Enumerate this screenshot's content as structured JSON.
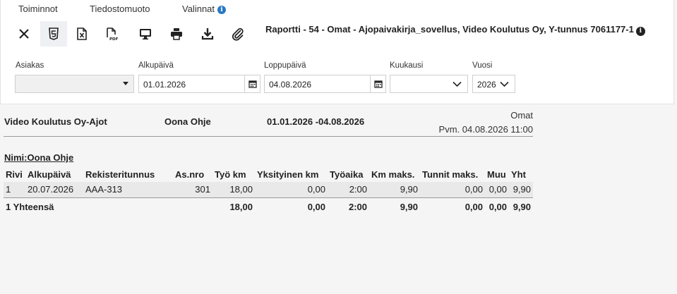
{
  "menu": {
    "toiminnot": "Toiminnot",
    "tiedostomuoto": "Tiedostomuoto",
    "valinnat": "Valinnat"
  },
  "toolbar": [
    {
      "name": "close-icon",
      "icon": "close"
    },
    {
      "name": "html5-icon",
      "icon": "html5"
    },
    {
      "name": "excel-icon",
      "icon": "excel"
    },
    {
      "name": "pdf-icon",
      "icon": "pdf"
    },
    {
      "name": "monitor-icon",
      "icon": "monitor"
    },
    {
      "name": "printer-icon",
      "icon": "printer"
    },
    {
      "name": "download-icon",
      "icon": "download"
    },
    {
      "name": "paperclip-icon",
      "icon": "paperclip"
    }
  ],
  "report_title": "Raportti - 54 - Omat - Ajopaivakirja_sovellus, Video Koulutus Oy, Y-tunnus 7061177-1",
  "filters": {
    "asiakas": {
      "label": "Asiakas",
      "value": ""
    },
    "alkupaiva": {
      "label": "Alkupäivä",
      "value": "01.01.2026"
    },
    "loppupaiva": {
      "label": "Loppupäivä",
      "value": "04.08.2026"
    },
    "kuukausi": {
      "label": "Kuukausi",
      "value": ""
    },
    "vuosi": {
      "label": "Vuosi",
      "value": "2026"
    }
  },
  "report": {
    "company": "Video Koulutus Oy-Ajot",
    "person": "Oona Ohje",
    "period_start": "01.01.2026",
    "period_sep": "-",
    "period_end": "04.08.2026",
    "type": "Omat",
    "pvm": "Pvm. 04.08.2026 11:00",
    "nimi": "Nimi:Oona Ohje",
    "columns": [
      "Rivi",
      "Alkupäivä",
      "Rekisteritunnus",
      "As.nro",
      "Työ km",
      "Yksityinen km",
      "Työaika",
      "Km maks.",
      "Tunnit maks.",
      "Muu",
      "Yht"
    ],
    "rows": [
      [
        "1",
        "20.07.2026",
        "AAA-313",
        "301",
        "18,00",
        "0,00",
        "2:00",
        "9,90",
        "0,00",
        "0,00",
        "9,90"
      ]
    ],
    "total": [
      "1 Yhteensä",
      "",
      "",
      "",
      "18,00",
      "0,00",
      "2:00",
      "9,90",
      "0,00",
      "0,00",
      "9,90"
    ]
  },
  "colors": {
    "info_blue": "#2a78c5",
    "text": "#222222",
    "row_bg": "#e9e9e9"
  }
}
